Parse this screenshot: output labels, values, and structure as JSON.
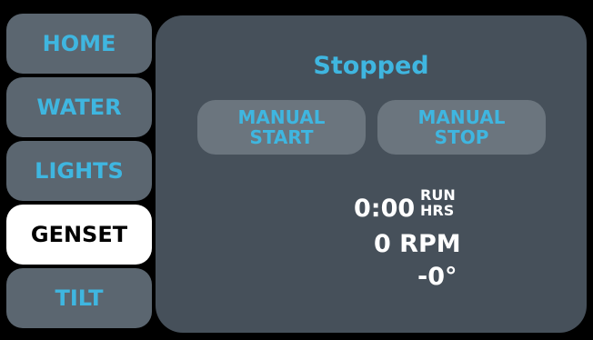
{
  "nav": {
    "items": [
      {
        "label": "HOME",
        "active": false
      },
      {
        "label": "WATER",
        "active": false
      },
      {
        "label": "LIGHTS",
        "active": false
      },
      {
        "label": "GENSET",
        "active": true
      },
      {
        "label": "TILT",
        "active": false
      }
    ]
  },
  "genset": {
    "status": "Stopped",
    "manual_start": [
      "MANUAL",
      "START"
    ],
    "manual_stop": [
      "MANUAL",
      "STOP"
    ],
    "run_time": "0:00",
    "run_label": [
      "RUN",
      "HRS"
    ],
    "rpm": "0 RPM",
    "angle": "-0°"
  },
  "colors": {
    "background": "#000000",
    "button_bg": "#5b6670",
    "active_bg": "#ffffff",
    "panel_bg": "#46505a",
    "accent": "#3fb6e0",
    "text": "#ffffff"
  }
}
